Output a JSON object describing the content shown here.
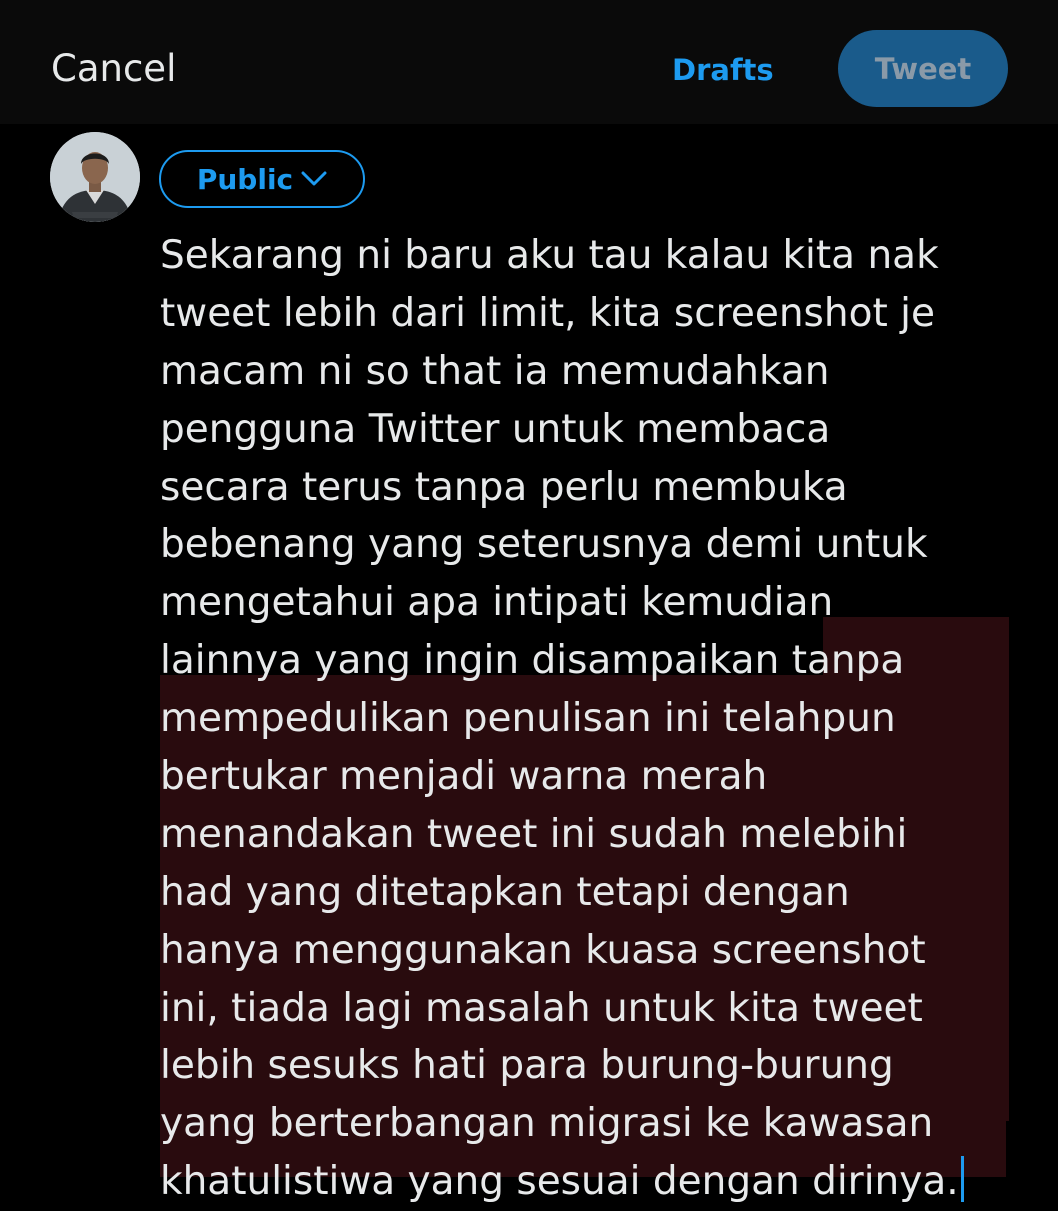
{
  "header": {
    "cancel_label": "Cancel",
    "drafts_label": "Drafts",
    "tweet_label": "Tweet"
  },
  "audience": {
    "label": "Public"
  },
  "icons": {
    "avatar": "profile-photo",
    "audience_dropdown": "chevron-down-icon",
    "cursor": "text-caret"
  },
  "colors": {
    "accent": "#1d9bf0",
    "tweet_button_disabled": "#1a5b8b",
    "overflow_highlight": "#290b0e",
    "background": "#000000"
  },
  "compose": {
    "lines": [
      "Sekarang ni baru aku tau kalau kita nak",
      "tweet lebih dari limit, kita screenshot je",
      "macam ni so that ia memudahkan",
      "pengguna Twitter untuk membaca",
      "secara terus tanpa perlu membuka",
      "bebenang yang seterusnya demi untuk",
      "mengetahui apa intipati kemudian",
      "lainnya yang ingin disampaikan tanpa",
      "mempedulikan penulisan ini telahpun",
      "bertukar menjadi warna merah",
      "menandakan tweet ini sudah melebihi",
      "had yang ditetapkan tetapi dengan",
      "hanya menggunakan kuasa screenshot",
      "ini, tiada lagi masalah untuk kita tweet",
      "lebih sesuks hati para burung-burung",
      "yang berterbangan migrasi ke kawasan",
      "khatulistiwa yang sesuai dengan dirinya."
    ]
  }
}
